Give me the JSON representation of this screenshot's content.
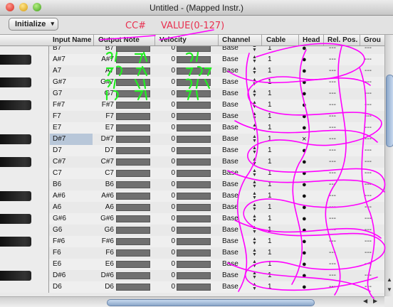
{
  "window": {
    "title": "Untitled -  (Mapped Instr.)"
  },
  "toolbar": {
    "initialize_label": "Initialize",
    "arrow": "▾"
  },
  "annotations": {
    "cc": "CC#",
    "value": "VALUE(0-127)",
    "color": "#ff00ff",
    "green": "#22ee22"
  },
  "columns": [
    "Input Name",
    "Output Note",
    "Velocity",
    "Channel",
    "Cable",
    "Head",
    "Rel. Pos.",
    "Grou"
  ],
  "rows": [
    {
      "name": "B7",
      "out": "B7",
      "vel": "0",
      "channel": "Base",
      "cable": "1",
      "head": "●",
      "rel": "---",
      "grp": "---",
      "black": false,
      "selected": false,
      "partial": true
    },
    {
      "name": "A#7",
      "out": "A#7",
      "vel": "0",
      "channel": "Base",
      "cable": "1",
      "head": "●",
      "rel": "---",
      "grp": "---",
      "black": true,
      "selected": false
    },
    {
      "name": "A7",
      "out": "A7",
      "vel": "0",
      "channel": "Base",
      "cable": "1",
      "head": "●",
      "rel": "---",
      "grp": "---",
      "black": false,
      "selected": false
    },
    {
      "name": "G#7",
      "out": "G#7",
      "vel": "0",
      "channel": "Base",
      "cable": "1",
      "head": "●",
      "rel": "---",
      "grp": "---",
      "black": true,
      "selected": false
    },
    {
      "name": "G7",
      "out": "G7",
      "vel": "0",
      "channel": "Base",
      "cable": "1",
      "head": "●",
      "rel": "---",
      "grp": "---",
      "black": false,
      "selected": false
    },
    {
      "name": "F#7",
      "out": "F#7",
      "vel": "0",
      "channel": "Base",
      "cable": "1",
      "head": "●",
      "rel": "---",
      "grp": "---",
      "black": true,
      "selected": false
    },
    {
      "name": "F7",
      "out": "F7",
      "vel": "0",
      "channel": "Base",
      "cable": "1",
      "head": "●",
      "rel": "---",
      "grp": "---",
      "black": false,
      "selected": false
    },
    {
      "name": "E7",
      "out": "E7",
      "vel": "0",
      "channel": "Base",
      "cable": "1",
      "head": "●",
      "rel": "---",
      "grp": "---",
      "black": false,
      "selected": false
    },
    {
      "name": "D#7",
      "out": "D#7",
      "vel": "0",
      "channel": "Base",
      "cable": "1",
      "head": "×",
      "rel": "---",
      "grp": "---",
      "black": true,
      "selected": true
    },
    {
      "name": "D7",
      "out": "D7",
      "vel": "0",
      "channel": "Base",
      "cable": "1",
      "head": "●",
      "rel": "---",
      "grp": "---",
      "black": false,
      "selected": false
    },
    {
      "name": "C#7",
      "out": "C#7",
      "vel": "0",
      "channel": "Base",
      "cable": "1",
      "head": "●",
      "rel": "---",
      "grp": "---",
      "black": true,
      "selected": false
    },
    {
      "name": "C7",
      "out": "C7",
      "vel": "0",
      "channel": "Base",
      "cable": "1",
      "head": "●",
      "rel": "---",
      "grp": "---",
      "black": false,
      "selected": false
    },
    {
      "name": "B6",
      "out": "B6",
      "vel": "0",
      "channel": "Base",
      "cable": "1",
      "head": "●",
      "rel": "---",
      "grp": "---",
      "black": false,
      "selected": false
    },
    {
      "name": "A#6",
      "out": "A#6",
      "vel": "0",
      "channel": "Base",
      "cable": "1",
      "head": "●",
      "rel": "---",
      "grp": "---",
      "black": true,
      "selected": false
    },
    {
      "name": "A6",
      "out": "A6",
      "vel": "0",
      "channel": "Base",
      "cable": "1",
      "head": "●",
      "rel": "---",
      "grp": "---",
      "black": false,
      "selected": false
    },
    {
      "name": "G#6",
      "out": "G#6",
      "vel": "0",
      "channel": "Base",
      "cable": "1",
      "head": "●",
      "rel": "---",
      "grp": "---",
      "black": true,
      "selected": false
    },
    {
      "name": "G6",
      "out": "G6",
      "vel": "0",
      "channel": "Base",
      "cable": "1",
      "head": "●",
      "rel": "---",
      "grp": "---",
      "black": false,
      "selected": false
    },
    {
      "name": "F#6",
      "out": "F#6",
      "vel": "0",
      "channel": "Base",
      "cable": "1",
      "head": "●",
      "rel": "---",
      "grp": "---",
      "black": true,
      "selected": false
    },
    {
      "name": "F6",
      "out": "F6",
      "vel": "0",
      "channel": "Base",
      "cable": "1",
      "head": "●",
      "rel": "---",
      "grp": "---",
      "black": false,
      "selected": false
    },
    {
      "name": "E6",
      "out": "E6",
      "vel": "0",
      "channel": "Base",
      "cable": "1",
      "head": "●",
      "rel": "---",
      "grp": "---",
      "black": false,
      "selected": false
    },
    {
      "name": "D#6",
      "out": "D#6",
      "vel": "0",
      "channel": "Base",
      "cable": "1",
      "head": "●",
      "rel": "---",
      "grp": "---",
      "black": true,
      "selected": false
    },
    {
      "name": "D6",
      "out": "D6",
      "vel": "0",
      "channel": "Base",
      "cable": "1",
      "head": "●",
      "rel": "---",
      "grp": "---",
      "black": false,
      "selected": false
    }
  ]
}
